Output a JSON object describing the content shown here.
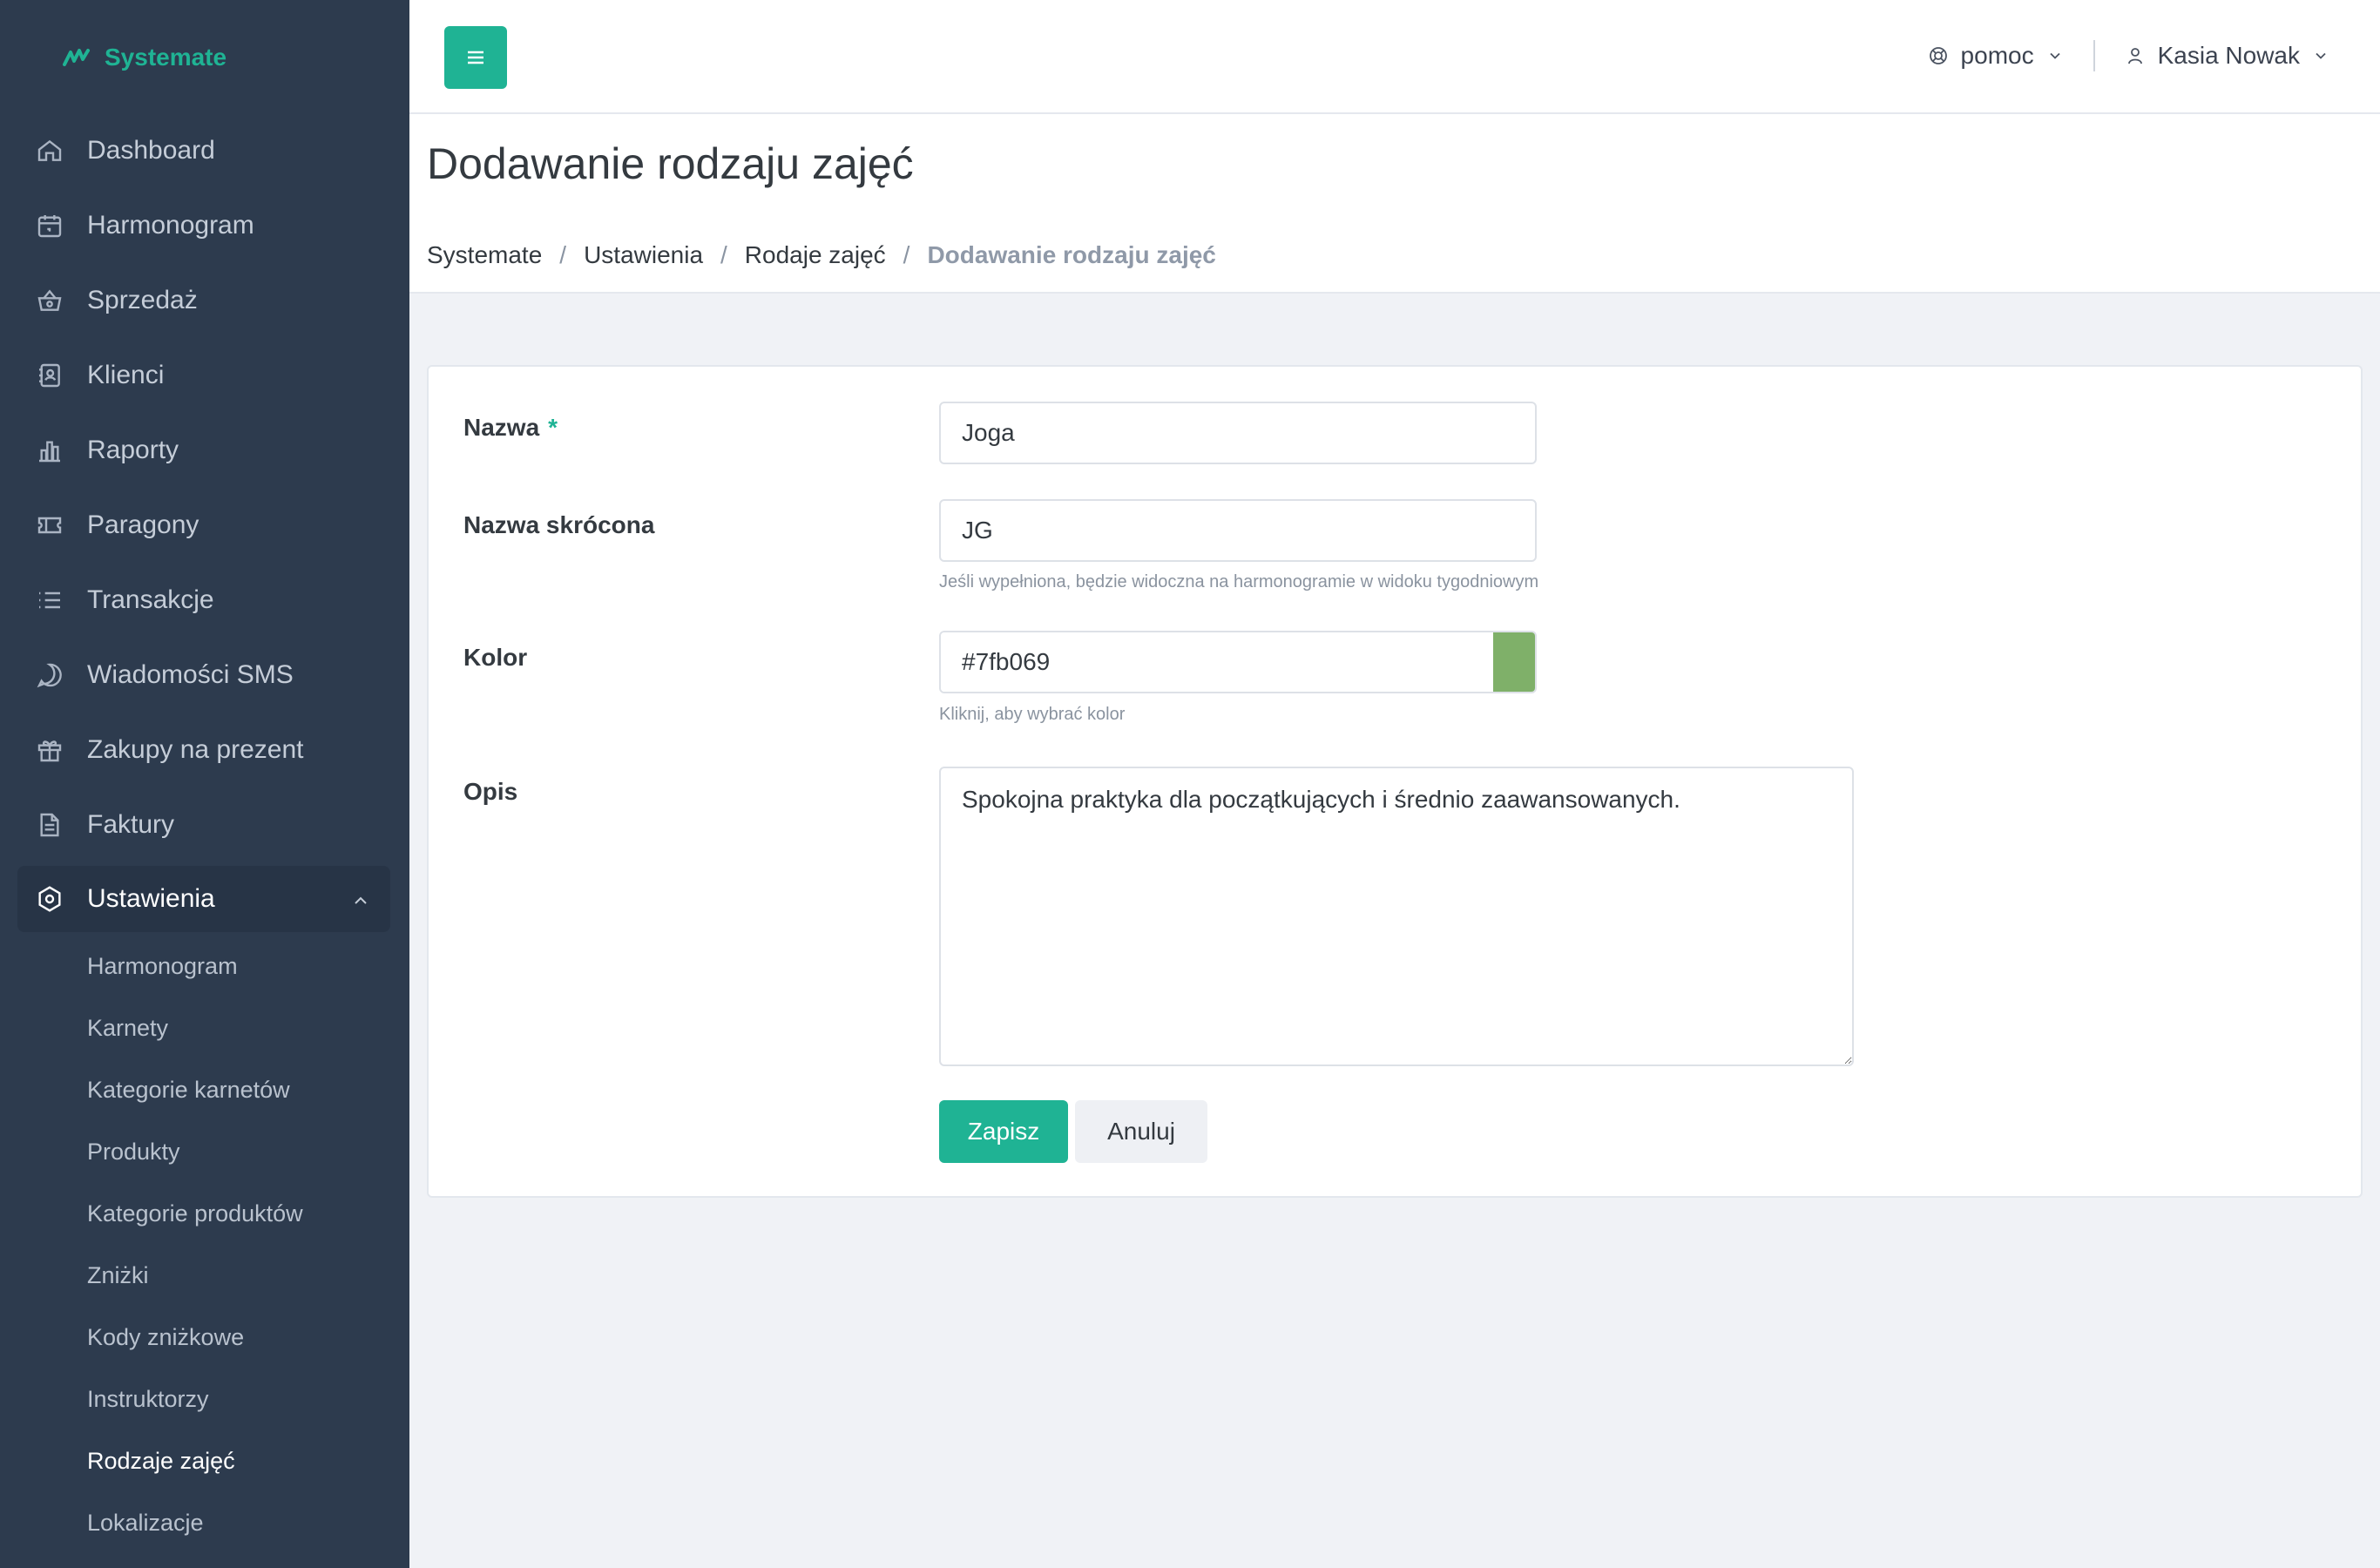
{
  "brand": {
    "name": "Systemate"
  },
  "sidebar": {
    "items": [
      {
        "label": "Dashboard",
        "icon": "home-icon"
      },
      {
        "label": "Harmonogram",
        "icon": "calendar-icon"
      },
      {
        "label": "Sprzedaż",
        "icon": "basket-icon"
      },
      {
        "label": "Klienci",
        "icon": "contacts-icon"
      },
      {
        "label": "Raporty",
        "icon": "bar-chart-icon"
      },
      {
        "label": "Paragony",
        "icon": "ticket-icon"
      },
      {
        "label": "Transakcje",
        "icon": "list-icon"
      },
      {
        "label": "Wiadomości SMS",
        "icon": "message-icon"
      },
      {
        "label": "Zakupy na prezent",
        "icon": "gift-icon"
      },
      {
        "label": "Faktury",
        "icon": "document-icon"
      },
      {
        "label": "Ustawienia",
        "icon": "settings-icon"
      }
    ],
    "subitems": [
      "Harmonogram",
      "Karnety",
      "Kategorie karnetów",
      "Produkty",
      "Kategorie produktów",
      "Zniżki",
      "Kody zniżkowe",
      "Instruktorzy",
      "Rodzaje zajęć",
      "Lokalizacje"
    ]
  },
  "topbar": {
    "help_label": "pomoc",
    "user_name": "Kasia Nowak"
  },
  "page": {
    "title": "Dodawanie rodzaju zajęć",
    "breadcrumb": [
      "Systemate",
      "Ustawienia",
      "Rodaje zajęć",
      "Dodawanie rodzaju zajęć"
    ]
  },
  "form": {
    "name_label": "Nazwa",
    "required_mark": "*",
    "name_value": "Joga",
    "short_label": "Nazwa skrócona",
    "short_value": "JG",
    "short_help": "Jeśli wypełniona, będzie widoczna na harmonogramie w widoku tygodniowym",
    "color_label": "Kolor",
    "color_value": "#7fb069",
    "color_help": "Kliknij, aby wybrać kolor",
    "desc_label": "Opis",
    "desc_value": "Spokojna praktyka dla początkujących i średnio zaawansowanych.",
    "save_label": "Zapisz",
    "cancel_label": "Anuluj"
  },
  "colors": {
    "accent": "#1fb394",
    "sidebar": "#2d3b4e",
    "swatch": "#7fb069"
  }
}
